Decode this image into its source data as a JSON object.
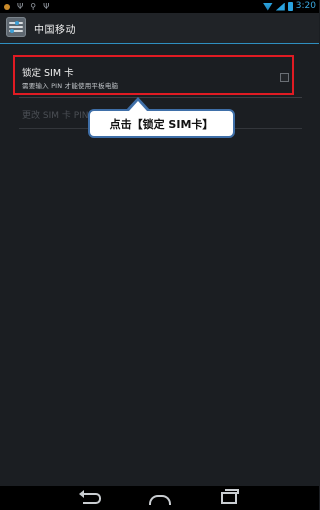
{
  "status_bar": {
    "time": "3:20",
    "left_icons": [
      "notification-icon",
      "psi-icon",
      "usb-icon",
      "psi-icon"
    ],
    "right_icons": [
      "wifi-icon",
      "signal-icon",
      "battery-icon"
    ],
    "accent": "#3aa8e0"
  },
  "action_bar": {
    "title": "中国移动",
    "icon": "settings-app-icon"
  },
  "prefs": {
    "lock_sim": {
      "title": "锁定 SIM 卡",
      "summary": "需要输入 PIN 才能使用平板电脑",
      "checked": false
    },
    "change_pin": {
      "title": "更改 SIM 卡 PIN",
      "enabled": false
    }
  },
  "callout": {
    "text": "点击【锁定 SIM卡】",
    "border_color": "#3f6fa8",
    "highlight_color": "#e01b23"
  },
  "nav_bar": {
    "buttons": [
      "back-icon",
      "home-icon",
      "recent-apps-icon"
    ]
  }
}
